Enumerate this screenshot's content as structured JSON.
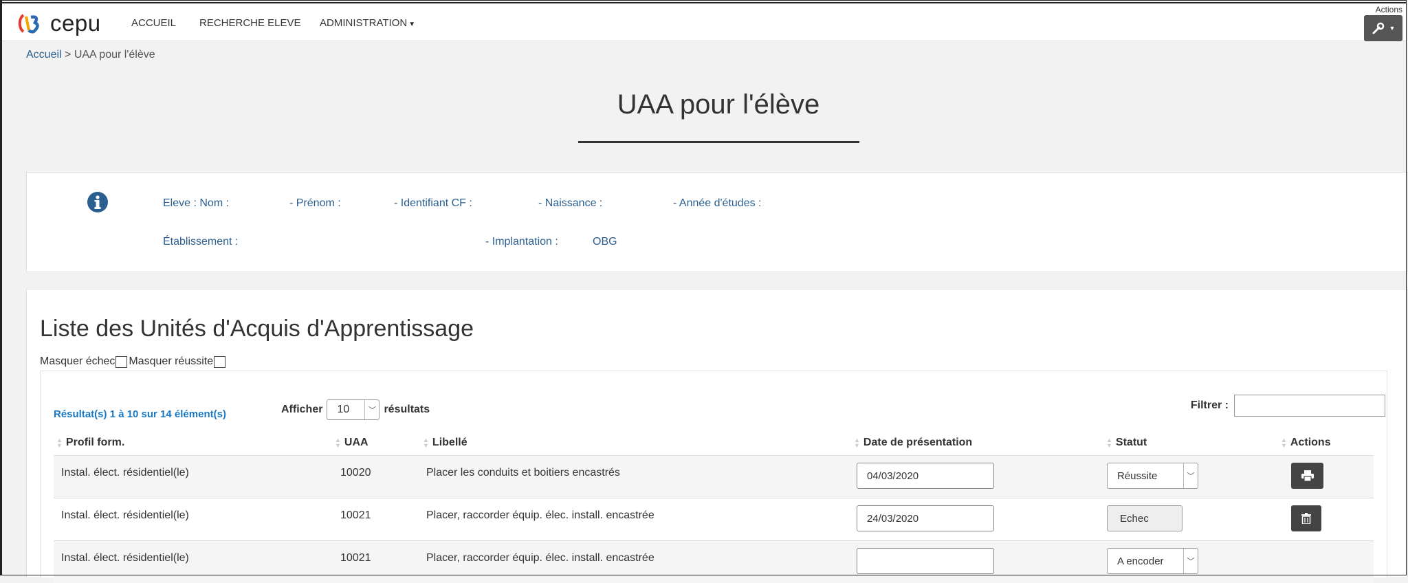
{
  "navbar": {
    "brand": "cepu",
    "items": [
      "ACCUEIL",
      "RECHERCHE ELEVE",
      "ADMINISTRATION"
    ],
    "actions_caption": "Actions"
  },
  "breadcrumb": {
    "home": "Accueil",
    "separator": ">",
    "current": "UAA pour l'élève"
  },
  "page_title": "UAA pour l'élève",
  "info": {
    "eleve_nom": "Eleve : Nom :",
    "prenom": "- Prénom :",
    "identifiant": "- Identifiant CF :",
    "naissance": "- Naissance :",
    "annee": "- Année d'études :",
    "etablissement": "Établissement :",
    "implantation": "- Implantation :",
    "implantation_value": "OBG"
  },
  "list": {
    "title": "Liste des Unités d'Acquis d'Apprentissage",
    "hide_fail": "Masquer échec",
    "hide_success": "Masquer réussite",
    "result_count": "Résultat(s) 1 à 10 sur 14 élément(s)",
    "show_label": "Afficher",
    "page_size": "10",
    "results_label": "résultats",
    "filter_label": "Filtrer :",
    "columns": [
      "Profil form.",
      "UAA",
      "Libellé",
      "Date de présentation",
      "Statut",
      "Actions"
    ],
    "rows": [
      {
        "profil": "Instal. élect. résidentiel(le)",
        "uaa": "10020",
        "libelle": "Placer les conduits et boitiers encastrés",
        "date": "04/03/2020",
        "statut": "Réussite",
        "action": "print-icon"
      },
      {
        "profil": "Instal. élect. résidentiel(le)",
        "uaa": "10021",
        "libelle": "Placer, raccorder équip. élec. install. encastrée",
        "date": "24/03/2020",
        "statut": "Echec",
        "action": "trash-icon"
      },
      {
        "profil": "Instal. élect. résidentiel(le)",
        "uaa": "10021",
        "libelle": "Placer, raccorder équip. élec. install. encastrée",
        "date": "",
        "statut": "A encoder",
        "action": ""
      }
    ]
  },
  "colors": {
    "link": "#2a5f8f",
    "result_count": "#1a78c2",
    "button_dark": "#444444"
  }
}
